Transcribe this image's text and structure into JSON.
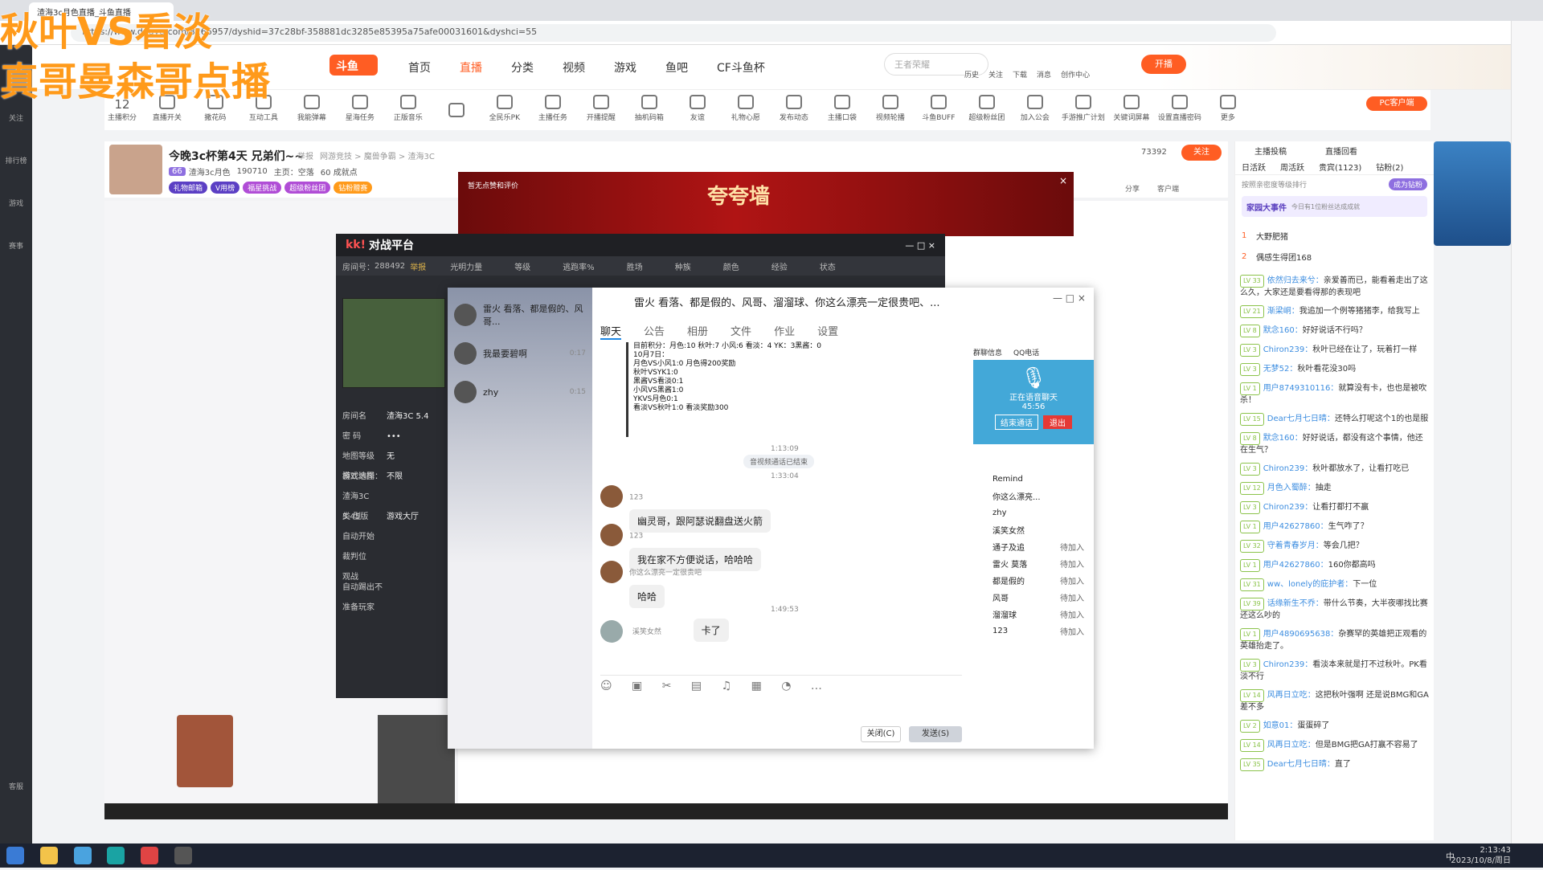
{
  "overlay": {
    "line1": "秋叶VS看淡",
    "line2": "真哥曼森哥点播"
  },
  "browser": {
    "tab_title": "渣海3c月色直播_斗鱼直播",
    "url": "https://www.douyu.com/8266957/dyshid=37c28bf-358881dc3285e85395a75afe00031601&dyshci=55"
  },
  "leftrail": [
    "关注",
    "排行榜",
    "游戏",
    "赛事",
    "客服"
  ],
  "header": {
    "nav": [
      "首页",
      "直播",
      "分类",
      "视频",
      "游戏",
      "鱼吧",
      "CF斗鱼杯"
    ],
    "active": "直播",
    "search_placeholder": "王者荣耀",
    "icons": [
      "历史",
      "关注",
      "下载",
      "消息",
      "创作中心"
    ],
    "cta": "开播"
  },
  "toolbar": [
    "主播积分",
    "直播开关",
    "撒花码",
    "互动工具",
    "我能弹幕",
    "星海任务",
    "正版音乐",
    "",
    "全民乐PK",
    "主播任务",
    "开播提醒",
    "抽机码箱",
    "友谊",
    "礼物心愿",
    "发布动态",
    "主播口袋",
    "视频轮播",
    "斗鱼BUFF",
    "超级粉丝团",
    "加入公会",
    "手游推广计划",
    "关键词屏幕",
    "设置直播密码",
    "更多"
  ],
  "toolbar_num": "12",
  "pc_client": "PC客户端",
  "room": {
    "title": "今晚3c杯第4天 兄弟们~~",
    "report": "举报",
    "meta": "网游竞技 > 魔兽争霸 > 渣海3C",
    "level": "66",
    "name": "渣海3c月色",
    "fans": "190710",
    "home": "主页：空落",
    "rank": "60 成就点",
    "viewers": "73392",
    "follow": "关注",
    "share": "分享",
    "client": "客户端",
    "tags": [
      "礼物邮箱",
      "V用榜",
      "福星挑战",
      "超级粉丝团",
      "钻粉赠赛"
    ]
  },
  "banner": {
    "text": "夸夸墙",
    "notice": "暂无点赞和评价"
  },
  "kk": {
    "title": "对战平台",
    "room_no_label": "房间号：",
    "room_no": "288492",
    "report": "举报",
    "cols": [
      "光明力量",
      "等级",
      "逃跑率%",
      "胜场",
      "种族",
      "颜色",
      "经验",
      "状态"
    ],
    "form": [
      [
        "房间名",
        "渣海3C 5.4"
      ],
      [
        "密  码",
        "•••"
      ],
      [
        "地图等级",
        "无"
      ],
      [
        "模式选择",
        "不限"
      ],
      [
        "游戏地图：渣海3C 5.45版",
        ""
      ],
      [
        "类  型",
        "游戏大厅"
      ],
      [
        "自动开始",
        ""
      ],
      [
        "裁判位",
        ""
      ],
      [
        "观战",
        ""
      ],
      [
        "自动踢出不准备玩家",
        ""
      ]
    ]
  },
  "qq": {
    "title": "雷火 看落、都是假的、风哥、溜溜球、你这么漂亮一定很贵吧、...",
    "tabs": [
      "聊天",
      "公告",
      "相册",
      "文件",
      "作业",
      "设置"
    ],
    "contacts": [
      [
        "雷火 看落、都是假的、风哥...",
        ""
      ],
      [
        "我最要碧啊",
        "0:17"
      ],
      [
        "zhy",
        "0:15"
      ]
    ],
    "score": "目前积分：月色:10 秋叶:7 小风:6 看淡：4 YK：3黑酱：0\n10月7日：\n月色VS小风1:0 月色得200奖励\n秋叶VSYK1:0\n黑酱VS看淡0:1\n小风VS黑酱1:0\nYKVS月色0:1\n看淡VS秋叶1:0 看淡奖励300",
    "t1": "1:13:09",
    "sys": "音视频通话已结束",
    "t2": "1:33:04",
    "msgs": [
      [
        "123",
        "幽灵哥，跟阿瑟说翻盘送火箭"
      ],
      [
        "123",
        "我在家不方便说话，哈哈哈"
      ],
      [
        "你这么漂亮一定很贵吧",
        "哈哈"
      ]
    ],
    "t3": "1:49:53",
    "last": [
      "溪笑女然",
      "卡了"
    ],
    "close": "关闭(C)",
    "send": "发送(S)",
    "vtabs": [
      "群聊信息",
      "QQ电话"
    ],
    "voice": "正在语音聊天",
    "vtime": "45:56",
    "vbtn1": "结束通话",
    "vbtn2": "退出",
    "members": [
      [
        "Remind",
        ""
      ],
      [
        "你这么漂亮...",
        ""
      ],
      [
        "zhy",
        ""
      ],
      [
        "溪笑女然",
        ""
      ],
      [
        "通子及追",
        "待加入"
      ],
      [
        "雷火 莫落",
        "待加入"
      ],
      [
        "都是假的",
        "待加入"
      ],
      [
        "风哥",
        "待加入"
      ],
      [
        "溜溜球",
        "待加入"
      ],
      [
        "123",
        "待加入"
      ]
    ]
  },
  "right": {
    "tabs1": [
      "主播投稿",
      "直播回看"
    ],
    "tabs2": [
      "日活跃",
      "周活跃",
      "贵宾(1123)",
      "钻粉(2)"
    ],
    "sub": "按照亲密度等级排行",
    "btn": "成为钻粉",
    "event": "家园大事件",
    "event_note": "今日有1位粉丝达成成就",
    "ranks": [
      [
        "1",
        "大野肥猪"
      ],
      [
        "2",
        "偶感生得团168"
      ]
    ],
    "chat": [
      [
        "LV 33",
        "依然归去来兮：",
        "亲爱善而已，能看着走出了这么久，大家还是要看得那的表现吧"
      ],
      [
        "LV 21",
        "渐梁峒：",
        "我追加一个例等猪猪李，给我写上"
      ],
      [
        "LV 8",
        "默念160：",
        "好好说话不行吗？"
      ],
      [
        "LV 3",
        "Chiron239：",
        "秋叶已经在让了，玩着打一样"
      ],
      [
        "LV 3",
        "无梦52：",
        "秋叶看花没30吗"
      ],
      [
        "LV 1",
        "用户8749310116：",
        "就算没有卡，也也是被吹杀！"
      ],
      [
        "LV 15",
        "Dear七月七日晴：",
        "还特么打呢这个1的也是服"
      ],
      [
        "LV 8",
        "默念160：",
        "好好说话，都没有这个事情，他还在生气？"
      ],
      [
        "LV 3",
        "Chiron239：",
        "秋叶都放水了，让看打吃已"
      ],
      [
        "LV 12",
        "月色入蜀醉：",
        "抽走"
      ],
      [
        "LV 3",
        "Chiron239：",
        "让看打都打不赢"
      ],
      [
        "LV 1",
        "用户42627860：",
        "生气咋了？"
      ],
      [
        "LV 32",
        "守着青春岁月：",
        "等会几把？"
      ],
      [
        "LV 1",
        "用户42627860：",
        "160你都高吗"
      ],
      [
        "LV 31",
        "ww、lonely的庇护者：",
        "下一位"
      ],
      [
        "LV 39",
        "话缘新生不乔：",
        "带什么节奏，大半夜哪找比赛还这么吵的"
      ],
      [
        "LV 1",
        "用户4890695638：",
        "杂赛罕的英雄把正观看的英雄抬走了。"
      ],
      [
        "LV 3",
        "Chiron239：",
        "看淡本来就是打不过秋叶。PK看淡不行"
      ],
      [
        "LV 14",
        "风再日立吃：",
        "这把秋叶强啊 还是说BMG和GA差不多"
      ],
      [
        "LV 2",
        "如意01：",
        "蛋蛋碎了"
      ],
      [
        "LV 14",
        "风再日立吃：",
        "但是BMG把GA打赢不容易了"
      ],
      [
        "LV 35",
        "Dear七月七日晴：",
        "直了"
      ]
    ]
  },
  "taskbar": {
    "time": "2:13:43",
    "date": "2023/10/8/周日",
    "ime": "中"
  }
}
